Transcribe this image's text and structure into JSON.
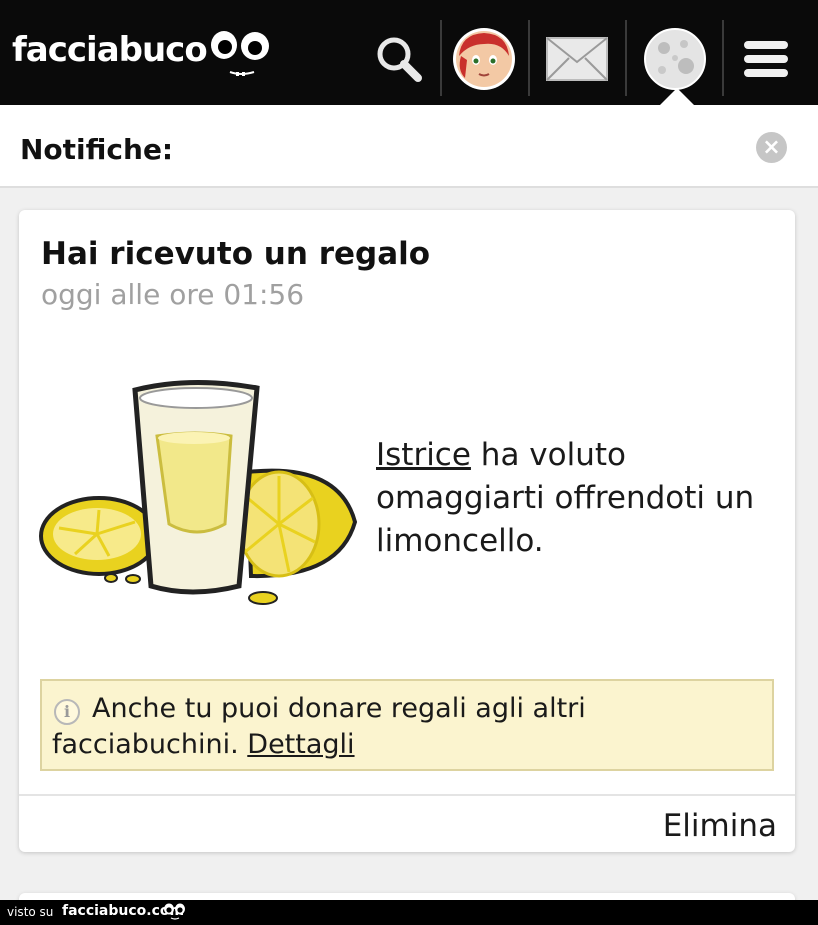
{
  "topbar": {
    "logo": "facciabuco",
    "icons": [
      "search-icon",
      "profile-avatar",
      "mail-icon",
      "notifications-moon-icon",
      "menu-icon"
    ]
  },
  "notifications": {
    "title": "Notifiche:",
    "close_icon": "close-icon"
  },
  "card": {
    "title": "Hai ricevuto un regalo",
    "time": "oggi alle ore 01:56",
    "gift_image": "limoncello-icon",
    "sender": "Istrice",
    "message": " ha voluto omaggiarti offrendoti un limoncello.",
    "info": {
      "text": "Anche tu puoi donare regali agli altri facciabuchini. ",
      "link": "Dettagli"
    },
    "delete_label": "Elimina"
  },
  "watermark": {
    "prefix": "visto su",
    "site": "facciabuco.com"
  },
  "colors": {
    "topbar": "#0a0a0a",
    "info_bg": "#fbf4cf",
    "muted_text": "#a0a0a0"
  }
}
